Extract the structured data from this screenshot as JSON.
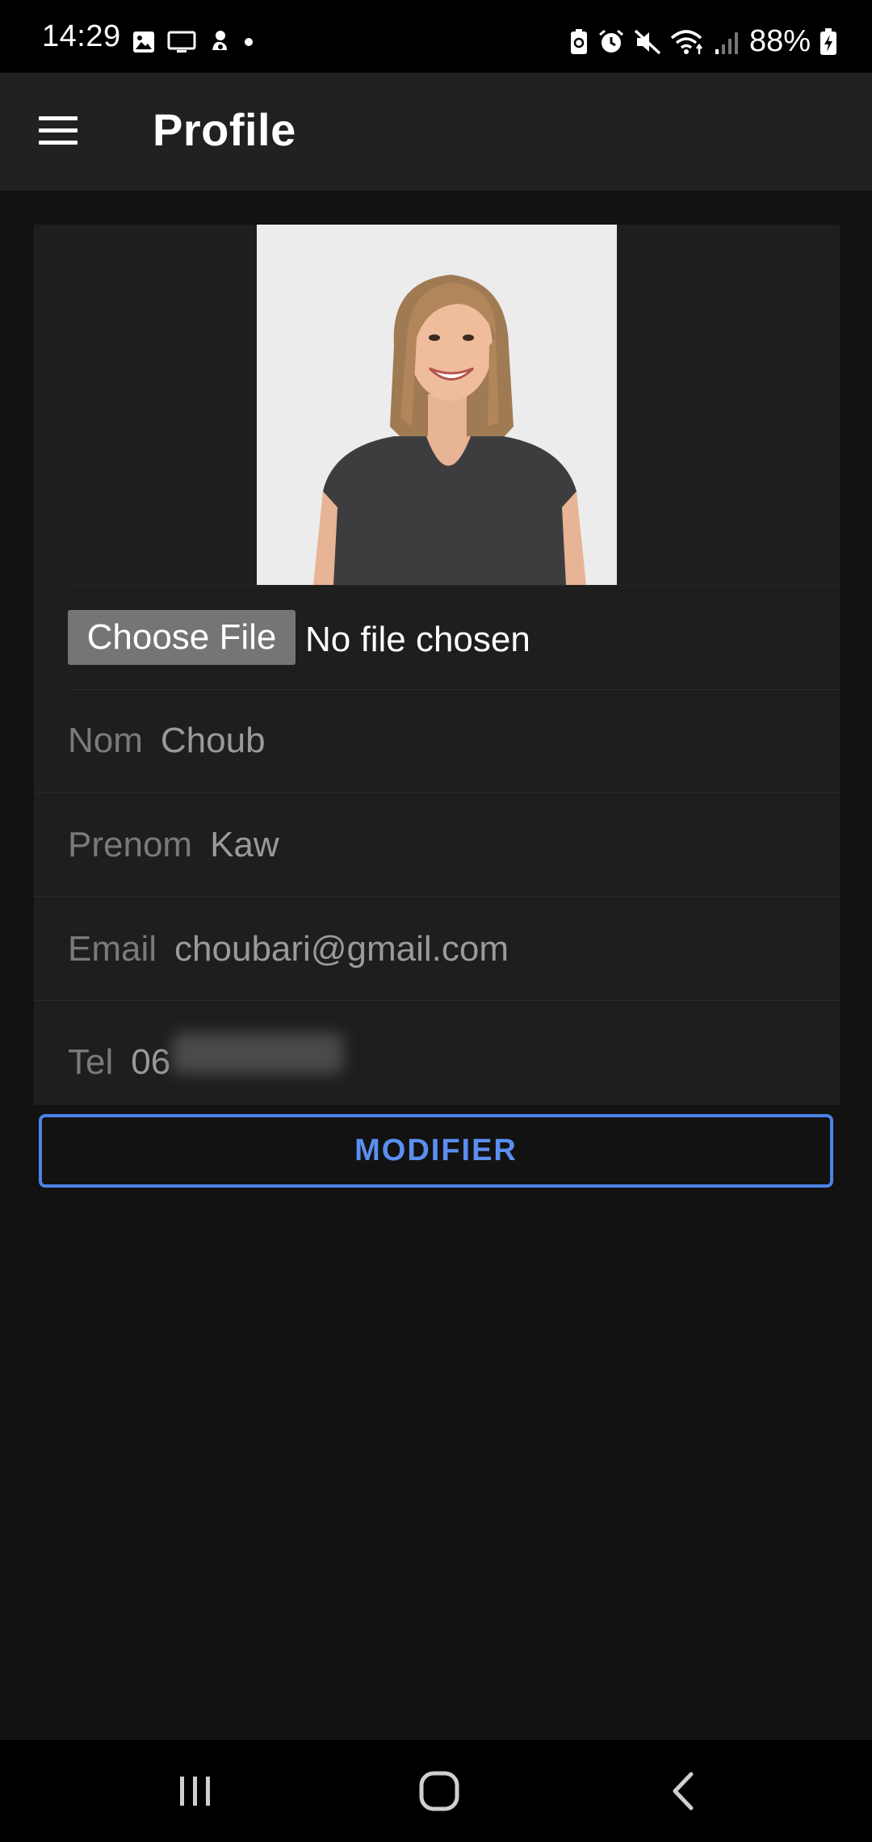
{
  "status_bar": {
    "time": "14:29",
    "battery": "88%",
    "left_icons": [
      "image-icon",
      "cast-icon",
      "notification-app-icon",
      "dot-icon"
    ],
    "right_icons": [
      "lock-battery-icon",
      "alarm-icon",
      "mute-icon",
      "wifi-icon",
      "signal-icon",
      "battery-icon"
    ]
  },
  "app_bar": {
    "title": "Profile",
    "menu_icon": "hamburger-menu-icon"
  },
  "profile": {
    "photo_alt": "profile-photo",
    "file_input": {
      "button_label": "Choose File",
      "status": "No file chosen"
    },
    "fields": [
      {
        "label": "Nom",
        "value": "Choub"
      },
      {
        "label": "Prenom",
        "value": "Kaw"
      },
      {
        "label": "Email",
        "value": "choubari@gmail.com"
      },
      {
        "label": "Tel",
        "value": "06"
      }
    ],
    "submit_label": "MODIFIER"
  },
  "colors": {
    "background": "#121212",
    "app_bar": "#212121",
    "card": "#1e1e1e",
    "accent": "#5b8ef0"
  },
  "nav_bar": {
    "icons": [
      "recents-icon",
      "home-icon",
      "back-icon"
    ]
  }
}
